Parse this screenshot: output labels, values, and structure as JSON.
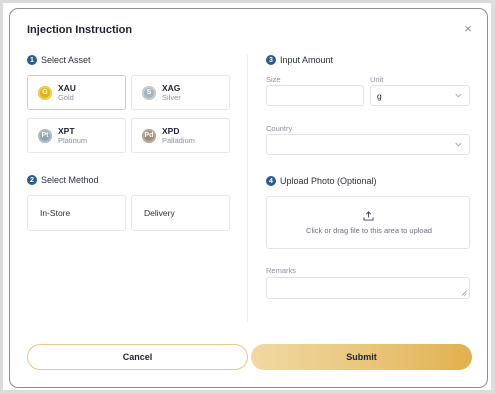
{
  "dialog": {
    "title": "Injection Instruction",
    "close_glyph": "×"
  },
  "step1": {
    "number": "1",
    "label": "Select Asset"
  },
  "assets": [
    {
      "code": "XAU",
      "name": "Gold",
      "badge": "G",
      "color": "#e3b021",
      "selected": true
    },
    {
      "code": "XAG",
      "name": "Silver",
      "badge": "S",
      "color": "#a7b2ba",
      "selected": false
    },
    {
      "code": "XPT",
      "name": "Platinum",
      "badge": "Pt",
      "color": "#8fa3ad",
      "selected": false
    },
    {
      "code": "XPD",
      "name": "Palladium",
      "badge": "Pd",
      "color": "#9c8f7b",
      "selected": false
    }
  ],
  "step2": {
    "number": "2",
    "label": "Select Method"
  },
  "methods": [
    {
      "label": "In-Store"
    },
    {
      "label": "Delivery"
    }
  ],
  "step3": {
    "number": "3",
    "label": "Input Amount"
  },
  "amount": {
    "size_label": "Size",
    "size_value": "",
    "unit_label": "Unit",
    "unit_value": "g",
    "country_label": "Country",
    "country_value": ""
  },
  "step4": {
    "number": "4",
    "label": "Upload Photo (Optional)"
  },
  "upload": {
    "text": "Click or drag file to this area to upload",
    "icon": "upload-icon"
  },
  "remarks": {
    "label": "Remarks",
    "value": ""
  },
  "actions": {
    "cancel_label": "Cancel",
    "submit_label": "Submit"
  },
  "colors": {
    "accent_gold": "#e8c986",
    "step_badge": "#2d5b8c"
  }
}
